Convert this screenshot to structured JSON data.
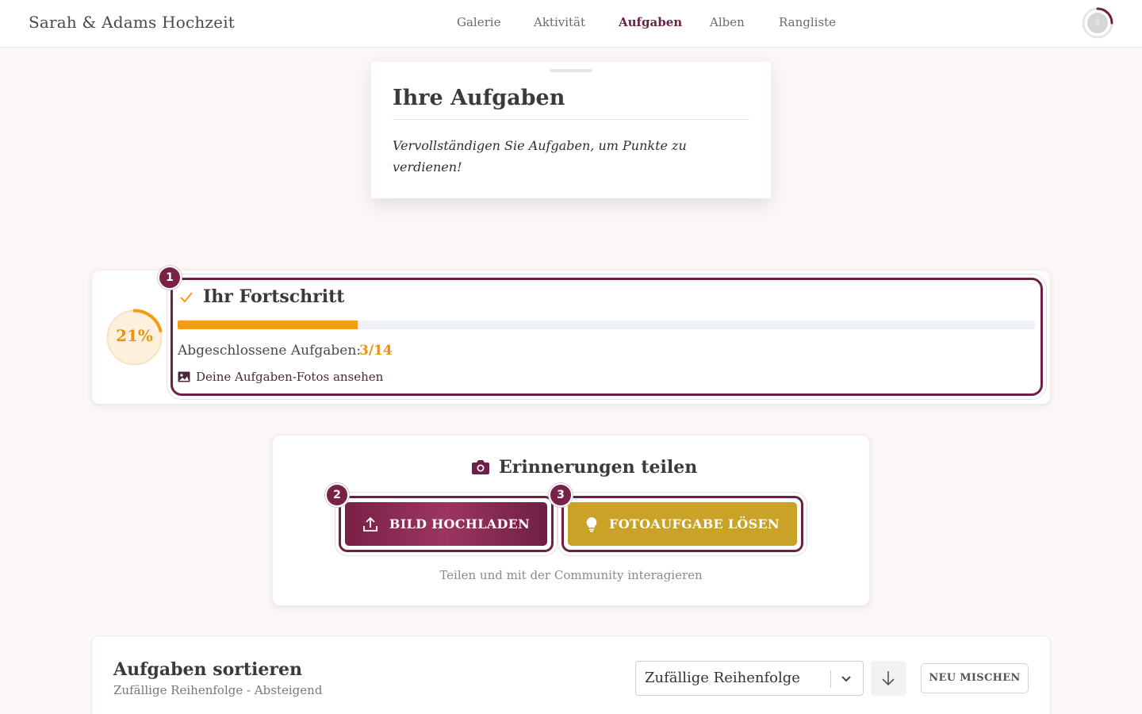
{
  "header": {
    "brand": "Sarah & Adams Hochzeit",
    "nav": [
      {
        "label": "Galerie"
      },
      {
        "label": "Aktivität"
      },
      {
        "label": "Aufgaben",
        "active": true
      },
      {
        "label": "Alben"
      },
      {
        "label": "Rangliste"
      }
    ],
    "avatar_initial": "S"
  },
  "intro": {
    "title": "Ihre Aufgaben",
    "text": "Vervollständigen Sie Aufgaben, um Punkte zu verdienen!"
  },
  "progress": {
    "badge": "1",
    "title": "Ihr Fortschritt",
    "percent_label": "21%",
    "fraction": 0.21,
    "completed_label": "Abgeschlossene Aufgaben:",
    "completed_count": "3/14",
    "photos_link": "Deine Aufgaben-Fotos ansehen"
  },
  "share": {
    "title": "Erinnerungen teilen",
    "upload_badge": "2",
    "upload_label": "BILD HOCHLADEN",
    "task_badge": "3",
    "task_label": "FOTOAUFGABE LÖSEN",
    "hint": "Teilen und mit der Community interagieren"
  },
  "sort": {
    "title": "Aufgaben sortieren",
    "subtitle": "Zufällige Reihenfolge - Absteigend",
    "selected": "Zufällige Reihenfolge",
    "shuffle_label": "NEU MISCHEN"
  },
  "colors": {
    "primary": "#6e1f45",
    "accent_orange": "#f59d12",
    "gold": "#c9a227",
    "background": "#fcf7f7"
  },
  "icons": [
    "check-icon",
    "image-icon",
    "camera-icon",
    "upload-icon",
    "lightbulb-icon",
    "chevron-down-icon",
    "arrow-down-icon"
  ]
}
